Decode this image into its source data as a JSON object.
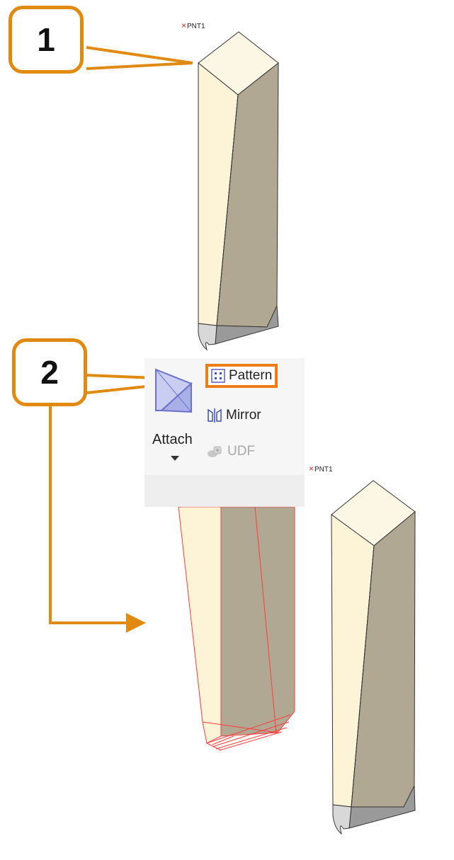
{
  "callouts": [
    {
      "number": "1"
    },
    {
      "number": "2"
    }
  ],
  "points": [
    {
      "marker": "×",
      "label": "PNT1"
    },
    {
      "marker": "×",
      "label": "PNT1"
    }
  ],
  "ribbon": {
    "attach": {
      "label": "Attach",
      "icon": "attach-icon"
    },
    "pattern": {
      "label": "Pattern",
      "icon": "pattern-icon",
      "highlighted": true
    },
    "mirror": {
      "label": "Mirror",
      "icon": "mirror-icon"
    },
    "udf": {
      "label": "UDF",
      "icon": "udf-icon",
      "disabled": true
    }
  },
  "colors": {
    "callout_border": "#e08a12",
    "highlight": "#ee7d18",
    "solid_light_face": "#fdf5dc",
    "solid_dark_face": "#b1a893",
    "preview_edge": "#ff3b3b",
    "point_marker": "#e0262d"
  }
}
